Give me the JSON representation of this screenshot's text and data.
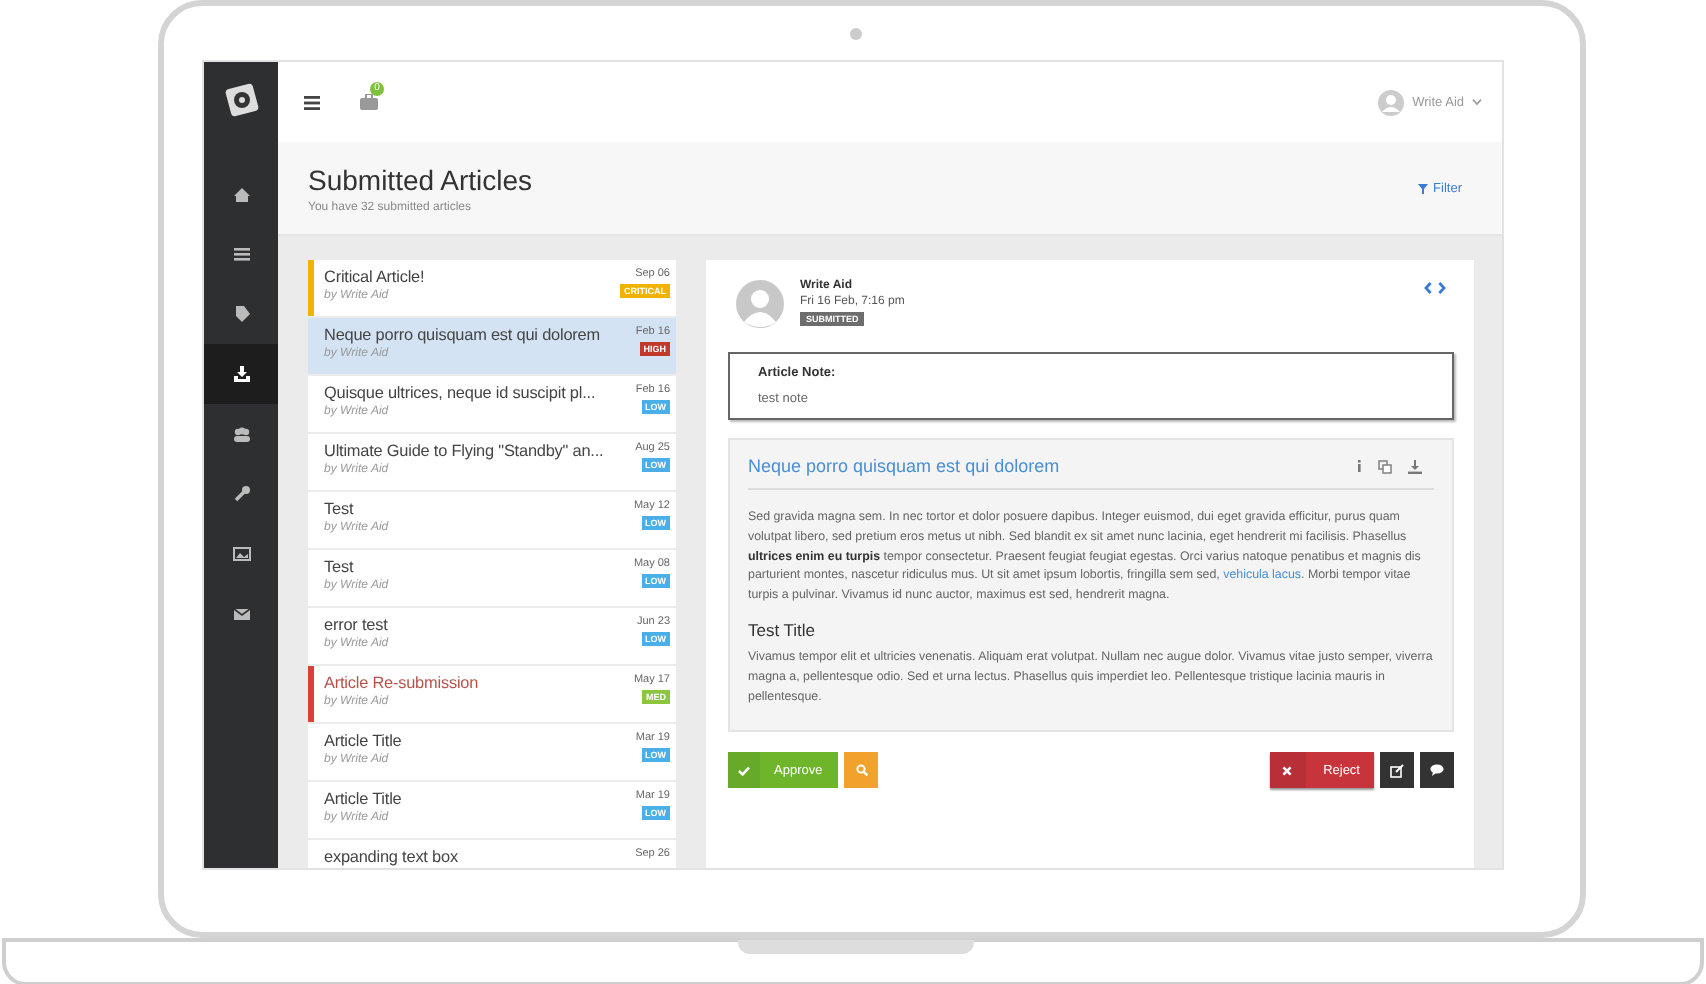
{
  "topbar": {
    "notification_count": "0",
    "user": "Write Aid"
  },
  "sidebar": {
    "items": [
      {
        "selected": false
      },
      {
        "selected": false
      },
      {
        "selected": false
      },
      {
        "selected": true
      },
      {
        "selected": false
      },
      {
        "selected": false
      },
      {
        "selected": false
      },
      {
        "selected": false
      }
    ]
  },
  "header": {
    "title": "Submitted Articles",
    "subtitle": "You have 32 submitted articles",
    "filter": "Filter"
  },
  "articles": [
    {
      "title": "Critical Article!",
      "author": "by Write Aid",
      "date": "Sep 06",
      "priority": "CRITICAL",
      "color": "#f0b400",
      "kind": "warning",
      "selected": false
    },
    {
      "title": "Neque porro quisquam est qui dolorem",
      "author": "by Write Aid",
      "date": "Feb 16",
      "priority": "HIGH",
      "color": "#c0392b",
      "kind": "plain",
      "selected": true
    },
    {
      "title": "Quisque ultrices, neque id suscipit pl...",
      "author": "by Write Aid",
      "date": "Feb 16",
      "priority": "LOW",
      "color": "#4aaee8",
      "kind": "plain",
      "selected": false
    },
    {
      "title": "Ultimate Guide to Flying \"Standby\" an...",
      "author": "by Write Aid",
      "date": "Aug 25",
      "priority": "LOW",
      "color": "#4aaee8",
      "kind": "plain",
      "selected": false
    },
    {
      "title": "Test",
      "author": "by Write Aid",
      "date": "May 12",
      "priority": "LOW",
      "color": "#4aaee8",
      "kind": "plain",
      "selected": false
    },
    {
      "title": "Test",
      "author": "by Write Aid",
      "date": "May 08",
      "priority": "LOW",
      "color": "#4aaee8",
      "kind": "plain",
      "selected": false
    },
    {
      "title": "error test",
      "author": "by Write Aid",
      "date": "Jun 23",
      "priority": "LOW",
      "color": "#4aaee8",
      "kind": "plain",
      "selected": false
    },
    {
      "title": "Article Re-submission",
      "author": "by Write Aid",
      "date": "May 17",
      "priority": "MED",
      "color": "#8cc63f",
      "kind": "resubmitted",
      "selected": false
    },
    {
      "title": "Article Title",
      "author": "by Write Aid",
      "date": "Mar 19",
      "priority": "LOW",
      "color": "#4aaee8",
      "kind": "plain",
      "selected": false
    },
    {
      "title": "Article Title",
      "author": "by Write Aid",
      "date": "Mar 19",
      "priority": "LOW",
      "color": "#4aaee8",
      "kind": "plain",
      "selected": false
    },
    {
      "title": "expanding text box",
      "date": "Sep 26",
      "kind": "cut",
      "selected": false
    }
  ],
  "detail": {
    "author": "Write Aid",
    "date": "Fri 16 Feb, 7:16 pm",
    "status": "SUBMITTED",
    "note": {
      "label": "Article Note:",
      "text": "test note"
    },
    "article": {
      "title": "Neque porro quisquam est qui dolorem",
      "body": [
        {
          "kind": "paragraph",
          "parts": [
            {
              "text": "Sed gravida magna sem. In nec tortor et dolor posuere dapibus. Integer euismod, dui eget gravida efficitur, purus quam volutpat libero, sed pretium eros metus ut nibh. Sed blandit ex sit amet nunc lacinia, eget hendrerit mi facilisis. Phasellus **ultrices enim eu turpis** tempor consectetur. Praesent feugiat feugiat egestas. Orci varius natoque penatibus et magnis dis parturient montes, nascetur ridiculus mus. Ut sit amet ipsum lobortis, fringilla sem sed, "
            },
            {
              "link": "vehicula lacus"
            },
            {
              "text": ". Morbi tempor vitae turpis a pulvinar. Vivamus id nunc auctor, maximus est sed, hendrerit magna."
            }
          ]
        },
        {
          "kind": "heading",
          "text": "Test Title"
        },
        {
          "kind": "paragraph",
          "parts": [
            {
              "text": "Vivamus tempor elit et ultricies venenatis. Aliquam erat volutpat. Nullam nec augue dolor. Vivamus vitae justo semper, viverra magna a, pellentesque odio. Sed et urna lectus. Phasellus quis imperdiet leo. Pellentesque tristique lacinia mauris in pellentesque."
            }
          ]
        }
      ]
    },
    "actions": [
      {
        "kind": "approve",
        "label": "Approve"
      },
      {
        "kind": "preview"
      },
      {
        "kind": "reject",
        "label": "Reject"
      },
      {
        "kind": "edit"
      },
      {
        "kind": "comment"
      }
    ]
  }
}
